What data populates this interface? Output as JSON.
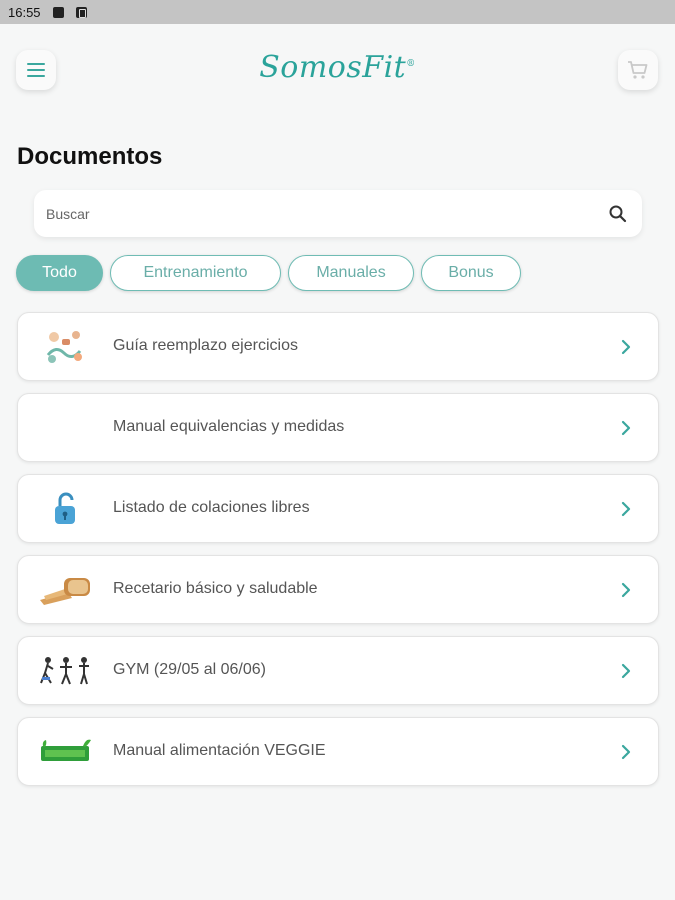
{
  "status_bar": {
    "time": "16:55"
  },
  "header": {
    "logo_text": "SomosFit",
    "logo_mark": "®",
    "menu_icon": "menu-icon",
    "cart_icon": "cart-icon"
  },
  "page": {
    "title": "Documentos"
  },
  "search": {
    "placeholder": "Buscar",
    "value": ""
  },
  "filters": [
    {
      "label": "Todo",
      "active": true
    },
    {
      "label": "Entrenamiento",
      "active": false
    },
    {
      "label": "Manuales",
      "active": false
    },
    {
      "label": "Bonus",
      "active": false
    }
  ],
  "documents": [
    {
      "title": "Guía reemplazo ejercicios",
      "thumb": "exercise-illustration-thumb"
    },
    {
      "title": "Manual equivalencias y medidas",
      "thumb": ""
    },
    {
      "title": "Listado de colaciones libres",
      "thumb": "padlock-thumb"
    },
    {
      "title": "Recetario básico y saludable",
      "thumb": "bread-thumb"
    },
    {
      "title": "GYM (29/05 al 06/06)",
      "thumb": "gym-figures-thumb"
    },
    {
      "title": "Manual alimentación VEGGIE",
      "thumb": "veggie-banner-thumb"
    }
  ],
  "colors": {
    "accent": "#6dbbb3",
    "brand": "#2aa39a",
    "chevron": "#3aa79e"
  }
}
